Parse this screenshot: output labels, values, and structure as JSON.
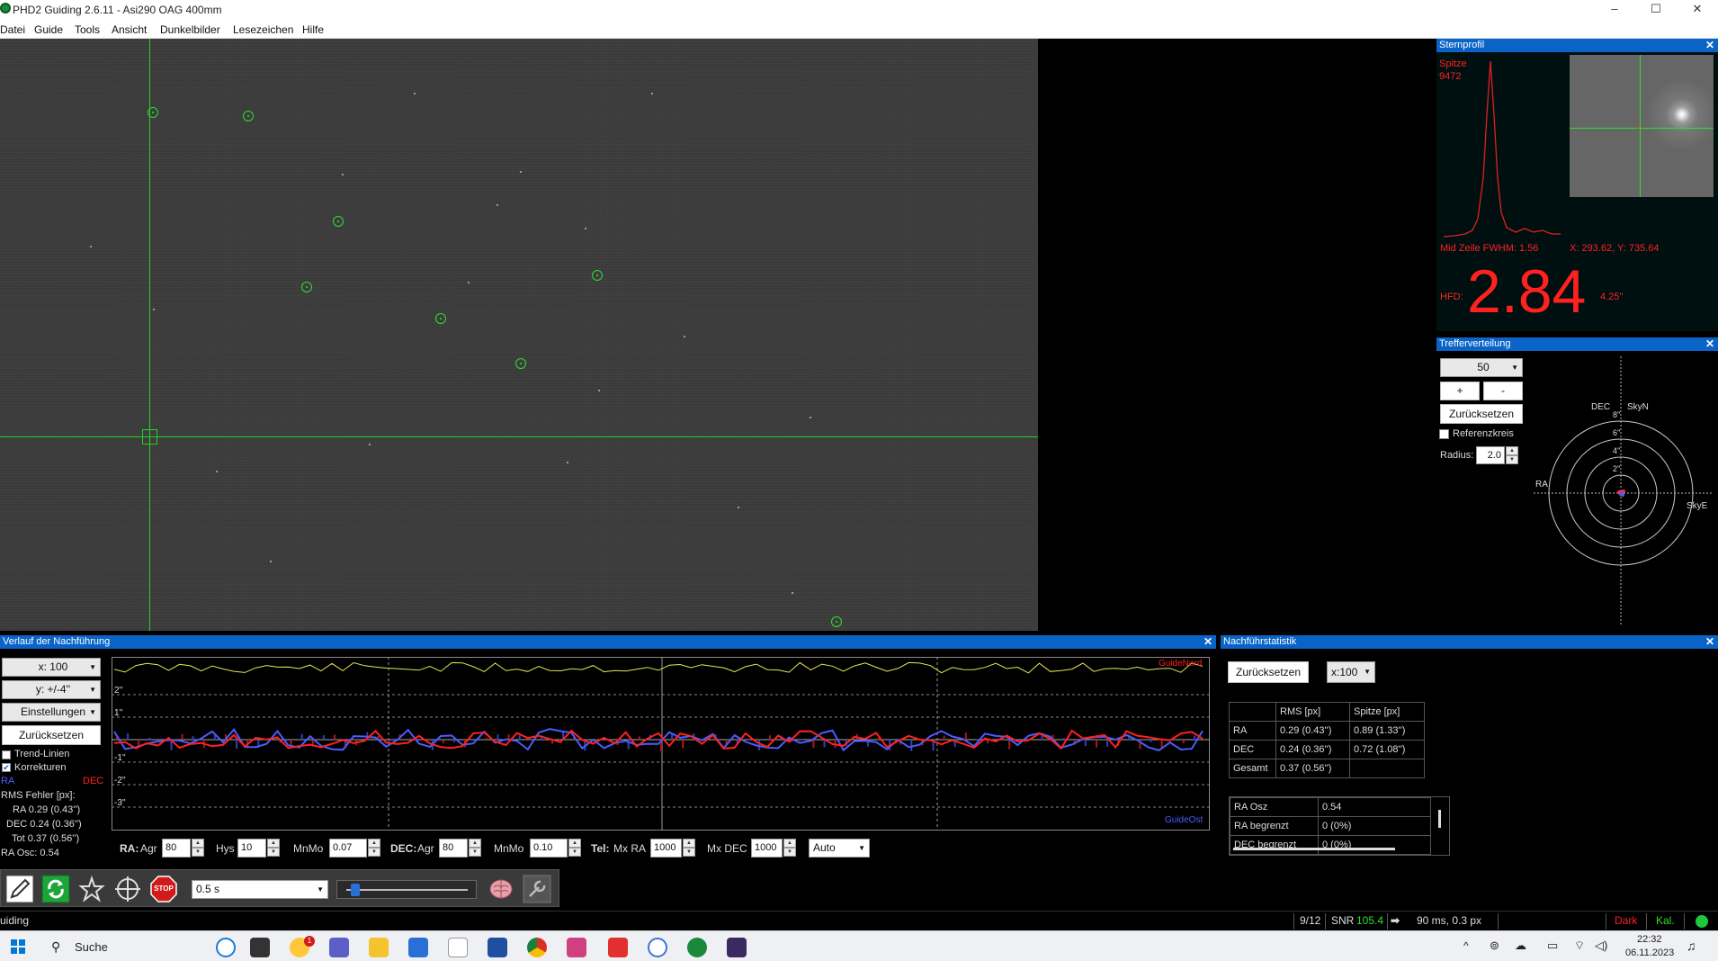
{
  "window": {
    "title": "PHD2 Guiding 2.6.11 - Asi290 OAG 400mm",
    "min": "–",
    "max": "☐",
    "close": "✕"
  },
  "menu": [
    "Datei",
    "Guide",
    "Tools",
    "Ansicht",
    "Dunkelbilder",
    "Lesezeichen",
    "Hilfe"
  ],
  "star_profile": {
    "title": "Sternprofil",
    "peak_label": "Spitze",
    "peak_value": "9472",
    "mid_row": "Mid Zeile FWHM: 1.56",
    "coords": "X: 293.62, Y: 735.64",
    "hfd_label": "HFD:",
    "hfd_value": "2.84",
    "hfd_arcsec": "4.25''"
  },
  "target": {
    "title": "Trefferverteilung",
    "length": "50",
    "plus": "+",
    "minus": "-",
    "reset": "Zurücksetzen",
    "ref_circle": "Referenzkreis",
    "radius_label": "Radius:",
    "radius_value": "2.0",
    "label_dec": "DEC",
    "label_skyn": "SkyN",
    "label_ra": "RA",
    "label_skye": "SkyE",
    "ring_labels": [
      "8''",
      "6''",
      "4''",
      "2''"
    ]
  },
  "graph": {
    "title": "Verlauf der Nachführung",
    "x_scale": "x: 100",
    "y_scale": "y: +/-4''",
    "settings": "Einstellungen",
    "reset": "Zurücksetzen",
    "trend_lines": "Trend-Linien",
    "corrections": "Korrekturen",
    "legend_ra": "RA",
    "legend_dec": "DEC",
    "rms_title": "RMS Fehler [px]:",
    "rms_ra": "RA  0.29 (0.43'')",
    "rms_dec": "DEC  0.24 (0.36'')",
    "rms_tot": "Tot  0.37 (0.56'')",
    "ra_osc": "RA Osc: 0.54",
    "corner_top": "GuideNord",
    "corner_bottom": "GuideOst",
    "ylabels": [
      "2''",
      "1''",
      "-1''",
      "-2''",
      "-3''"
    ],
    "ra_label": "RA:",
    "ra_agr_label": "Agr",
    "ra_agr": "80",
    "hys_label": "Hys",
    "hys": "10",
    "mnmo_label": "MnMo",
    "ra_mnmo": "0.07",
    "dec_label": "DEC:",
    "dec_agr_label": "Agr",
    "dec_agr": "80",
    "dec_mnmo_label": "MnMo",
    "dec_mnmo": "0.10",
    "tel_label": "Tel:",
    "mx_ra_label": "Mx RA",
    "mx_ra": "1000",
    "mx_dec_label": "Mx DEC",
    "mx_dec": "1000",
    "dec_mode": "Auto"
  },
  "stats": {
    "title": "Nachführstatistik",
    "reset": "Zurücksetzen",
    "x_scale": "x:100",
    "headers": [
      "",
      "RMS [px]",
      "Spitze [px]"
    ],
    "rows": [
      [
        "RA",
        "0.29 (0.43'')",
        "0.89 (1.33'')"
      ],
      [
        "DEC",
        "0.24 (0.36'')",
        "0.72 (1.08'')"
      ],
      [
        "Gesamt",
        "0.37 (0.56'')",
        ""
      ]
    ],
    "rows2": [
      [
        "RA Osz",
        "0.54"
      ],
      [
        "RA begrenzt",
        "0 (0%)"
      ],
      [
        "DEC begrenzt",
        "0 (0%)"
      ]
    ]
  },
  "toolbar": {
    "exposure": "0.5 s",
    "stop": "STOP"
  },
  "status": {
    "mode": "uiding",
    "frame": "9/12",
    "snr_label": "SNR",
    "snr": "105.4",
    "guide": "90 ms, 0.3 px",
    "dark": "Dark",
    "cal": "Kal."
  },
  "taskbar": {
    "search": "Suche",
    "time": "22:32",
    "date": "06.11.2023",
    "badge": "1"
  },
  "colors": {
    "accent": "#0a64c8",
    "guide_ra": "#4a5cff",
    "guide_dec": "#ff2020",
    "snr": "#2de02d",
    "target_marker": "#2de02d"
  }
}
